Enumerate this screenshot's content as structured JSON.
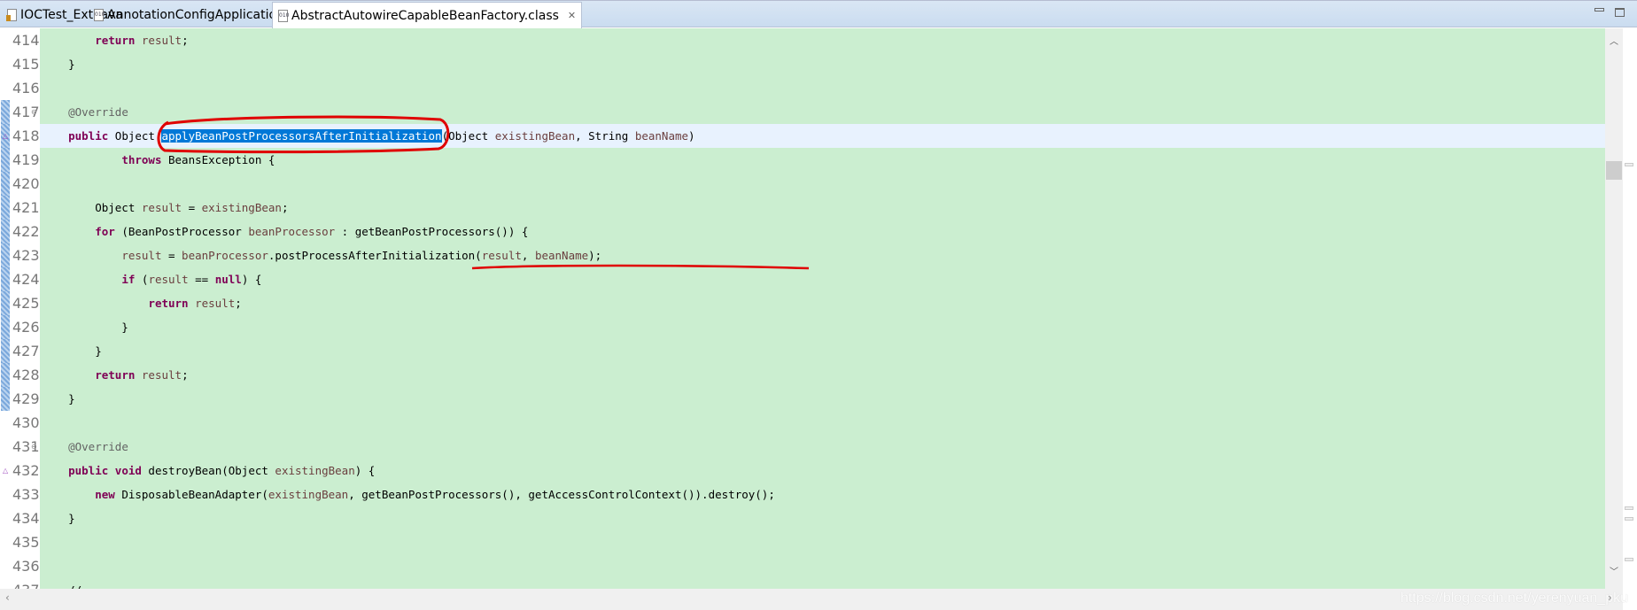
{
  "tabs": [
    {
      "label": "IOCTest_Ext.java",
      "icon": "java-file-icon",
      "active": false
    },
    {
      "label": "AnnotationConfigApplicationContext.class",
      "icon": "class-file-icon",
      "active": false
    },
    {
      "label": "AbstractAutowireCapableBeanFactory.class",
      "icon": "class-file-icon",
      "active": true
    }
  ],
  "close_label": "✕",
  "editor": {
    "current_line": 418,
    "lines": [
      {
        "n": "414",
        "t": [
          [
            "        ",
            ""
          ],
          [
            "return",
            "kw"
          ],
          [
            " ",
            ""
          ],
          [
            "result",
            "var"
          ],
          [
            ";",
            ""
          ]
        ]
      },
      {
        "n": "415",
        "t": [
          [
            "    }",
            ""
          ]
        ]
      },
      {
        "n": "416",
        "t": []
      },
      {
        "n": "417",
        "fold": true,
        "t": [
          [
            "    ",
            ""
          ],
          [
            "@Override",
            "ann"
          ]
        ]
      },
      {
        "n": "418",
        "override": true,
        "t": [
          [
            "    ",
            ""
          ],
          [
            "public",
            "kw"
          ],
          [
            " Object ",
            ""
          ],
          [
            "applyBeanPostProcessorsAfterInitialization",
            "sel"
          ],
          [
            "(Object ",
            ""
          ],
          [
            "existingBean",
            "var"
          ],
          [
            ", String ",
            ""
          ],
          [
            "beanName",
            "var"
          ],
          [
            ")",
            ""
          ]
        ]
      },
      {
        "n": "419",
        "t": [
          [
            "            ",
            ""
          ],
          [
            "throws",
            "kw"
          ],
          [
            " BeansException {",
            ""
          ]
        ]
      },
      {
        "n": "420",
        "t": []
      },
      {
        "n": "421",
        "t": [
          [
            "        Object ",
            ""
          ],
          [
            "result",
            "var"
          ],
          [
            " = ",
            ""
          ],
          [
            "existingBean",
            "var"
          ],
          [
            ";",
            ""
          ]
        ]
      },
      {
        "n": "422",
        "t": [
          [
            "        ",
            ""
          ],
          [
            "for",
            "kw"
          ],
          [
            " (BeanPostProcessor ",
            ""
          ],
          [
            "beanProcessor",
            "var"
          ],
          [
            " : getBeanPostProcessors()) {",
            ""
          ]
        ]
      },
      {
        "n": "423",
        "t": [
          [
            "            ",
            ""
          ],
          [
            "result",
            "var"
          ],
          [
            " = ",
            ""
          ],
          [
            "beanProcessor",
            "var"
          ],
          [
            ".postProcessAfterInitialization(",
            ""
          ],
          [
            "result",
            "var"
          ],
          [
            ", ",
            ""
          ],
          [
            "beanName",
            "var"
          ],
          [
            ");",
            ""
          ]
        ]
      },
      {
        "n": "424",
        "t": [
          [
            "            ",
            ""
          ],
          [
            "if",
            "kw"
          ],
          [
            " (",
            ""
          ],
          [
            "result",
            "var"
          ],
          [
            " == ",
            ""
          ],
          [
            "null",
            "kw"
          ],
          [
            ") {",
            ""
          ]
        ]
      },
      {
        "n": "425",
        "t": [
          [
            "                ",
            ""
          ],
          [
            "return",
            "kw"
          ],
          [
            " ",
            ""
          ],
          [
            "result",
            "var"
          ],
          [
            ";",
            ""
          ]
        ]
      },
      {
        "n": "426",
        "t": [
          [
            "            }",
            ""
          ]
        ]
      },
      {
        "n": "427",
        "t": [
          [
            "        }",
            ""
          ]
        ]
      },
      {
        "n": "428",
        "t": [
          [
            "        ",
            ""
          ],
          [
            "return",
            "kw"
          ],
          [
            " ",
            ""
          ],
          [
            "result",
            "var"
          ],
          [
            ";",
            ""
          ]
        ]
      },
      {
        "n": "429",
        "t": [
          [
            "    }",
            ""
          ]
        ]
      },
      {
        "n": "430",
        "t": []
      },
      {
        "n": "431",
        "fold": true,
        "t": [
          [
            "    ",
            ""
          ],
          [
            "@Override",
            "ann"
          ]
        ]
      },
      {
        "n": "432",
        "override": true,
        "t": [
          [
            "    ",
            ""
          ],
          [
            "public",
            "kw"
          ],
          [
            " ",
            ""
          ],
          [
            "void",
            "kw"
          ],
          [
            " destroyBean(Object ",
            ""
          ],
          [
            "existingBean",
            "var"
          ],
          [
            ") {",
            ""
          ]
        ]
      },
      {
        "n": "433",
        "t": [
          [
            "        ",
            ""
          ],
          [
            "new",
            "kw"
          ],
          [
            " DisposableBeanAdapter(",
            ""
          ],
          [
            "existingBean",
            "var"
          ],
          [
            ", getBeanPostProcessors(), getAccessControlContext()).destroy();",
            ""
          ]
        ]
      },
      {
        "n": "434",
        "t": [
          [
            "    }",
            ""
          ]
        ]
      },
      {
        "n": "435",
        "t": []
      },
      {
        "n": "436",
        "t": []
      },
      {
        "n": "437",
        "t": [
          [
            "    //",
            ""
          ]
        ]
      }
    ]
  },
  "watermark": "https://blog.csdn.net/yerenyuan_pku",
  "colors": {
    "keyword": "#7f0055",
    "variable": "#6a3e3e",
    "annotation": "#646464",
    "background": "#cbeed0",
    "selection": "#0078d7",
    "current_line": "#e8f2fe",
    "markup": "#ff0000"
  }
}
